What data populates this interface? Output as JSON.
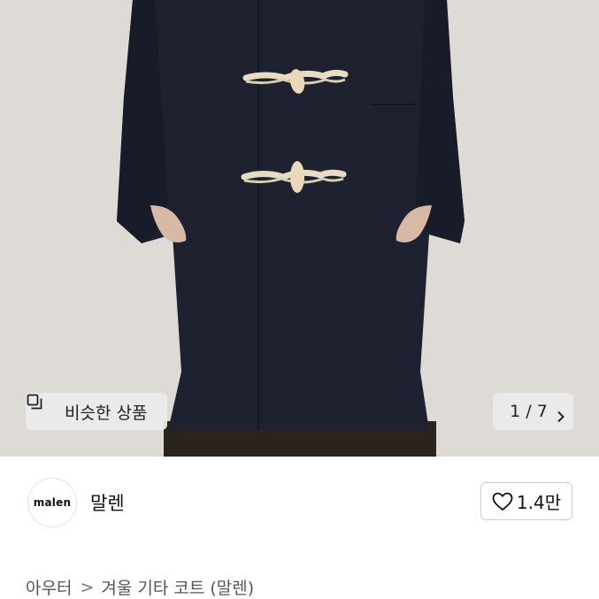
{
  "image": {
    "alt": "navy duffle coat with toggle buttons"
  },
  "similar_button": {
    "label": "비슷한 상품",
    "icon": "similar-items-icon"
  },
  "image_counter": {
    "current": "1",
    "sep": " / ",
    "total": "7",
    "icon": "chevron-right-icon"
  },
  "shop": {
    "logo_text": "malen",
    "name": "말렌"
  },
  "like_button": {
    "count": "1.4만",
    "icon": "heart-outline-icon"
  },
  "breadcrumb": {
    "category": "아우터",
    "separator": ">",
    "item": "겨울 기타 코트 (말렌)"
  },
  "colors": {
    "coat": "#1d2130",
    "background": "#dedbd6",
    "toggle": "#e8dcc4"
  }
}
